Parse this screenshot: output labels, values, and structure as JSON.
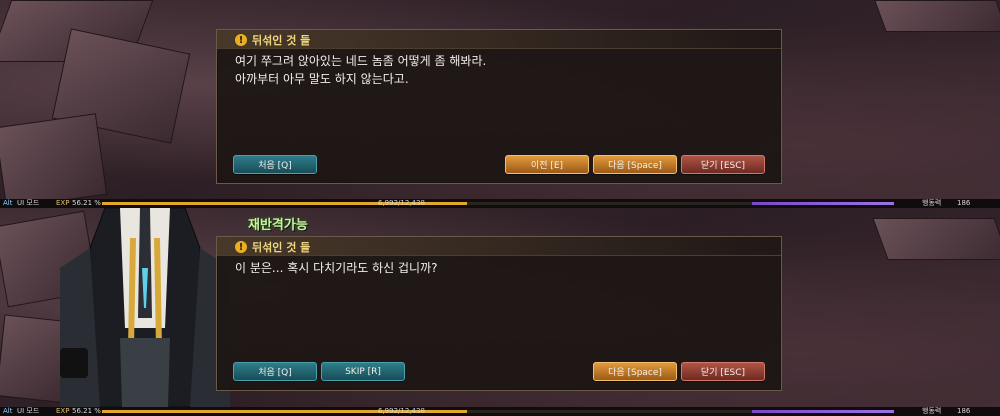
{
  "speaker_name": "뒤섞인 것 들",
  "dialog1": {
    "lines": [
      "여기 쭈그려 앉아있는 네드 놈좀 어떻게 좀 해봐라.",
      "아까부터 아무 말도 하지 않는다고."
    ],
    "buttons": {
      "first": "처음 [Q]",
      "prev": "이전 [E]",
      "next": "다음 [Space]",
      "close": "닫기 [ESC]"
    }
  },
  "dialog2": {
    "lines": [
      "이 분은... 혹시 다치기라도 하신 겁니까?"
    ],
    "buttons": {
      "first": "처음 [Q]",
      "skip": "SKIP [R]",
      "next": "다음 [Space]",
      "close": "닫기 [ESC]"
    }
  },
  "counter_label": "재반격가능",
  "hud": {
    "mode_key": "Alt",
    "mode_label": "UI 모드",
    "exp_label": "EXP",
    "exp_percent_text": "56.21 %",
    "exp_percent": 56.21,
    "exp_values": "6,992/12,438",
    "ap_label": "행동력",
    "ap_value": "186"
  },
  "colors": {
    "teal_button": "#2f7d8a",
    "orange_button": "#e29a3d",
    "red_button": "#b05446",
    "exp_bar": "#e2a72b",
    "ap_bar": "#7a48c8",
    "speaker_text": "#f0d880"
  }
}
